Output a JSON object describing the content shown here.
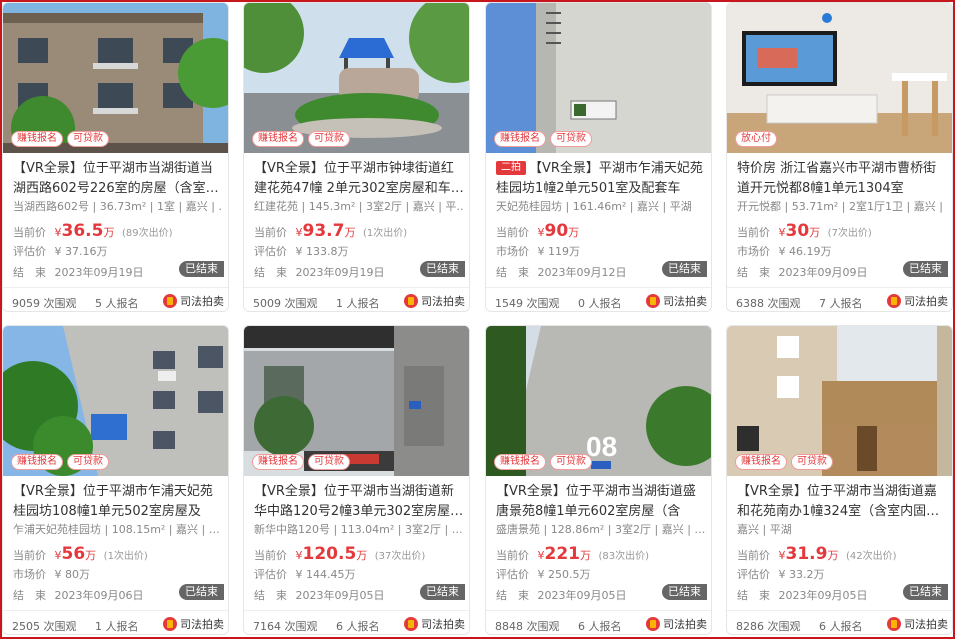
{
  "labels": {
    "current_price": "当前价",
    "ended_at": "结　束",
    "ended_badge": "已结束",
    "views_suffix": "次围观",
    "signups_suffix": "人报名",
    "source": "司法拍卖",
    "price_unit": "万"
  },
  "listings": [
    {
      "tags": [
        "赚钱报名",
        "可贷款"
      ],
      "hot": "",
      "title": "【VR全景】位于平湖市当湖街道当湖西路602号226室的房屋（含室…",
      "sub": "当湖西路602号 | 36.73m² | 1室 | 嘉兴 | …",
      "price": "36.5",
      "bids": "(89次出价)",
      "ref_label": "评估价",
      "ref_value": "¥ 37.16万",
      "end_date": "2023年09月19日",
      "views": "9059",
      "signups": "5",
      "scene": "apartment-balconies"
    },
    {
      "tags": [
        "赚钱报名",
        "可贷款"
      ],
      "hot": "",
      "title": "【VR全景】位于平湖市钟埭街道红建花苑47幢 2单元302室房屋和车…",
      "sub": "红建花苑 | 145.3m² | 3室2厅 | 嘉兴 | 平…",
      "price": "93.7",
      "bids": "(1次出价)",
      "ref_label": "评估价",
      "ref_value": "¥ 133.8万",
      "end_date": "2023年09月19日",
      "views": "5009",
      "signups": "1",
      "scene": "gate-garden"
    },
    {
      "tags": [
        "赚钱报名",
        "可贷款"
      ],
      "hot": "二拍",
      "title": "【VR全景】平湖市乍浦天妃苑桂园坊1幢2单元501室及配套车库…",
      "sub": "天妃苑桂园坊 | 161.46m² | 嘉兴 | 平湖",
      "price": "90",
      "bids": "",
      "ref_label": "市场价",
      "ref_value": "¥ 119万",
      "end_date": "2023年09月12日",
      "views": "1549",
      "signups": "0",
      "scene": "wall-sky"
    },
    {
      "tags": [
        "放心付"
      ],
      "hot": "",
      "title": "特价房 浙江省嘉兴市平湖市曹桥街道开元悦都8幢1单元1304室",
      "sub": "开元悦都 | 53.71m² | 2室1厅1卫 | 嘉兴 | …",
      "price": "30",
      "bids": "(7次出价)",
      "ref_label": "市场价",
      "ref_value": "¥ 46.19万",
      "end_date": "2023年09月09日",
      "views": "6388",
      "signups": "7",
      "scene": "living-room"
    },
    {
      "tags": [
        "赚钱报名",
        "可贷款"
      ],
      "hot": "",
      "title": "【VR全景】位于平湖市乍浦天妃苑桂园坊108幢1单元502室房屋及车…",
      "sub": "乍浦天妃苑桂园坊 | 108.15m² | 嘉兴 | …",
      "price": "56",
      "bids": "(1次出价)",
      "ref_label": "市场价",
      "ref_value": "¥ 80万",
      "end_date": "2023年09月06日",
      "views": "2505",
      "signups": "1",
      "scene": "apartment-tree"
    },
    {
      "tags": [
        "赚钱报名",
        "可贷款"
      ],
      "hot": "",
      "title": "【VR全景】位于平湖市当湖街道新华中路120号2幢3单元302室房屋…",
      "sub": "新华中路120号 | 113.04m² | 3室2厅 | …",
      "price": "120.5",
      "bids": "(37次出价)",
      "ref_label": "评估价",
      "ref_value": "¥ 144.45万",
      "end_date": "2023年09月05日",
      "views": "7164",
      "signups": "6",
      "scene": "street-sign"
    },
    {
      "tags": [
        "赚钱报名",
        "可贷款"
      ],
      "hot": "",
      "title": "【VR全景】位于平湖市当湖街道盛唐景苑8幢1单元602室房屋（含室…",
      "sub": "盛唐景苑 | 128.86m² | 3室2厅 | 嘉兴 | …",
      "price": "221",
      "bids": "(83次出价)",
      "ref_label": "评估价",
      "ref_value": "¥ 250.5万",
      "end_date": "2023年09月05日",
      "views": "8848",
      "signups": "6",
      "scene": "building-08"
    },
    {
      "tags": [
        "赚钱报名",
        "可贷款"
      ],
      "hot": "",
      "title": "【VR全景】位于平湖市当湖街道嘉和花苑南办1幢324室（含室内固…",
      "sub": "嘉兴 | 平湖",
      "price": "31.9",
      "bids": "(42次出价)",
      "ref_label": "评估价",
      "ref_value": "¥ 33.2万",
      "end_date": "2023年09月05日",
      "views": "8286",
      "signups": "6",
      "scene": "building-facade"
    }
  ]
}
